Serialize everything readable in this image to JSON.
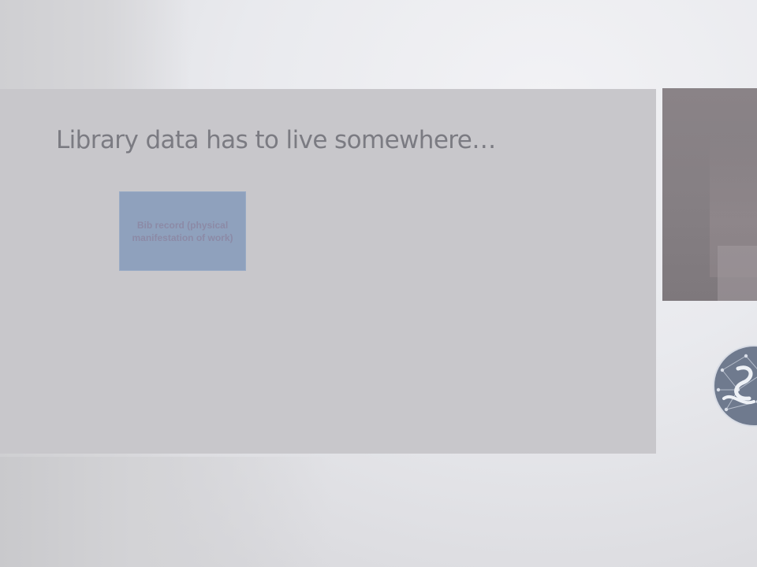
{
  "slide": {
    "title": "Library data has to live somewhere…",
    "boxes": [
      {
        "label": "Bib record (physical manifestation of work)"
      }
    ]
  },
  "icons": {
    "logo": "network-globe-logo-icon"
  },
  "colors": {
    "panel": "#c8c7cb",
    "title_text": "#7b7b82",
    "box_fill": "#8fa1bd",
    "box_text": "#8c8aa6",
    "photo": "#867f83",
    "logo": "#6f7a8e"
  }
}
